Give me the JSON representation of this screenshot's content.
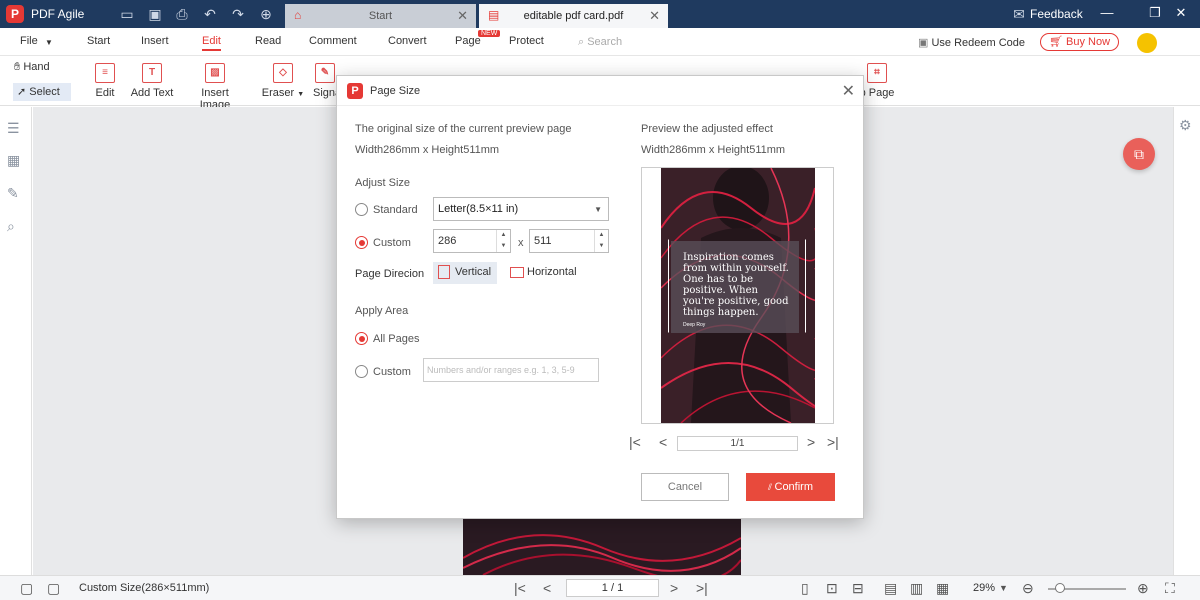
{
  "app": {
    "name": "PDF Agile",
    "logo_letter": "P"
  },
  "tabs": [
    {
      "label": "Start"
    },
    {
      "label": "editable pdf card.pdf"
    }
  ],
  "header": {
    "feedback_label": "Feedback"
  },
  "menu": {
    "items": [
      "File",
      "Start",
      "Insert",
      "Edit",
      "Read",
      "Comment",
      "Convert",
      "Page",
      "Protect"
    ],
    "active": "Edit",
    "new_badge": "NEW",
    "search_placeholder": "Search",
    "redeem_label": "Use Redeem Code",
    "buy_label": "Buy Now"
  },
  "toolbar": {
    "hand_label": "Hand",
    "select_label": "Select",
    "edit_label": "Edit",
    "add_text_label": "Add Text",
    "insert_image_label": "Insert Image",
    "eraser_label": "Eraser",
    "signature_label": "Signa",
    "crop_label": "p Page"
  },
  "status": {
    "page_size": "Custom Size(286×511mm)",
    "page_indicator": "1 / 1",
    "zoom": "29%"
  },
  "dialog": {
    "title": "Page Size",
    "original_label": "The original size of the current preview page",
    "original_size": "Width286mm x Height511mm",
    "adjust_label": "Adjust Size",
    "standard_label": "Standard",
    "standard_value": "Letter(8.5×11 in)",
    "custom_label": "Custom",
    "width_value": "286",
    "times": "x",
    "height_value": "511",
    "direction_label": "Page Direcion",
    "vertical_label": "Vertical",
    "horizontal_label": "Horizontal",
    "apply_label": "Apply Area",
    "all_pages_label": "All Pages",
    "custom_range_label": "Custom",
    "range_placeholder": "Numbers and/or ranges e.g. 1, 3, 5-9",
    "preview_label": "Preview the adjusted effect",
    "preview_size": "Width286mm x Height511mm",
    "pager": "1/1",
    "cancel_label": "Cancel",
    "confirm_label": "Confirm"
  },
  "preview_card": {
    "quote": "Inspiration comes from within yourself. One has to be positive. When you're positive, good things happen.",
    "author": "Deep Roy"
  }
}
